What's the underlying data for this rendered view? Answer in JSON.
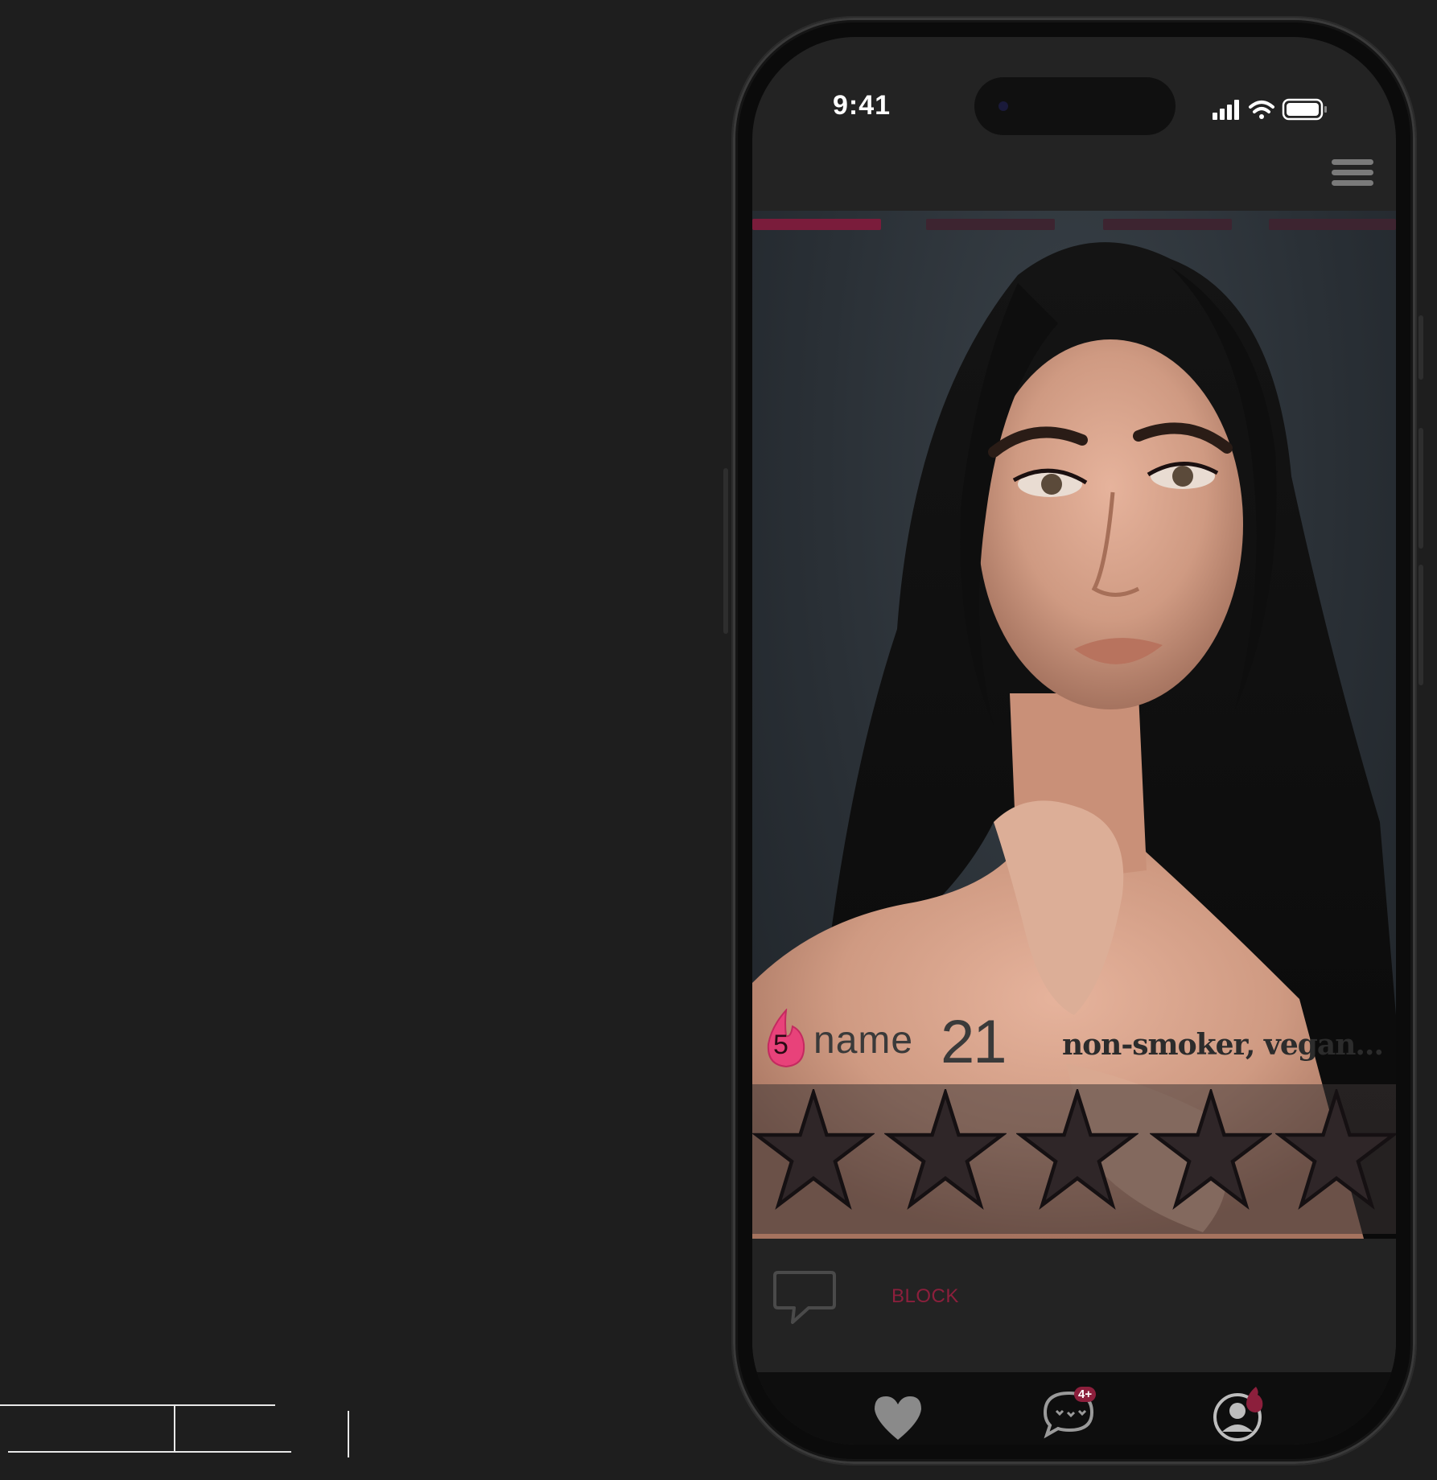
{
  "status_bar": {
    "time": "9:41"
  },
  "profile": {
    "flame_count": "5",
    "name": "name",
    "age": "21",
    "tags": "non-smoker, vegan..."
  },
  "rating": {
    "max_stars": 5,
    "value": 0
  },
  "photo_pager": {
    "total": 4,
    "current": 1
  },
  "actions": {
    "block_label": "BLOCK"
  },
  "tabbar": {
    "messages_badge": "4+"
  },
  "colors": {
    "accent": "#8c1f3c",
    "flame": "#e8427a",
    "background": "#1e1e1e"
  },
  "icons": [
    "menu-icon",
    "chat-bubble-icon",
    "heart-icon",
    "messages-icon",
    "profile-icon",
    "flame-icon",
    "star-icon"
  ]
}
